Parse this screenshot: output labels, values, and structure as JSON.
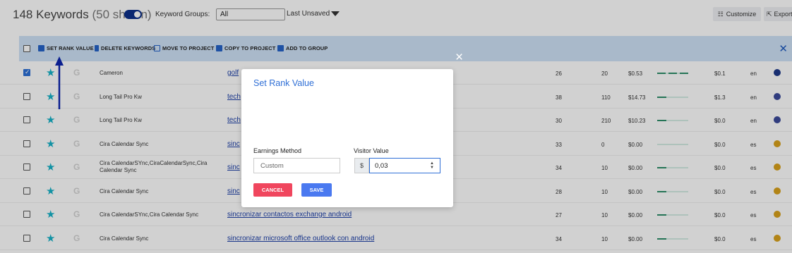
{
  "header": {
    "keyword_count": "148 Keywords",
    "shown_count": "(50 shown)",
    "keyword_groups_label": "Keyword Groups:",
    "keyword_groups_value": "All",
    "view_label": "Last Unsaved",
    "customize_label": "Customize",
    "export_label": "Export"
  },
  "action_bar": {
    "set_rank_value": "SET RANK VALUE",
    "delete_keywords": "DELETE KEYWORDS",
    "move_to_project": "MOVE TO PROJECT",
    "copy_to_project": "COPY TO PROJECT",
    "add_to_group": "ADD TO GROUP"
  },
  "rows": [
    {
      "group": "Cameron",
      "keyword": "golf",
      "c1": "26",
      "c2": "20",
      "c3": "$0.53",
      "trend": "dash",
      "trend_level": 1.0,
      "c5": "$0.1",
      "lang": "en",
      "checked": true,
      "flag_color": "#1f3a8a"
    },
    {
      "group": "Long Tail Pro Kw",
      "keyword": "tech",
      "c1": "38",
      "c2": "110",
      "c3": "$14.73",
      "trend": "bar",
      "trend_level": 0.3,
      "c5": "$1.3",
      "lang": "en",
      "checked": false,
      "flag_color": "#3b4a9a"
    },
    {
      "group": "Long Tail Pro Kw",
      "keyword": "tech",
      "c1": "30",
      "c2": "210",
      "c3": "$10.23",
      "trend": "bar",
      "trend_level": 0.3,
      "c5": "$0.0",
      "lang": "en",
      "checked": false,
      "flag_color": "#3b4a9a"
    },
    {
      "group": "Cira Calendar Sync",
      "keyword": "sinc",
      "c1": "33",
      "c2": "0",
      "c3": "$0.00",
      "trend": "bar",
      "trend_level": 0.0,
      "c5": "$0.0",
      "lang": "es",
      "checked": false,
      "flag_color": "#d9a21b"
    },
    {
      "group": "Cira CalendarSYnc,CiraCalendarSync,Cira Calendar Sync",
      "keyword": "sinc",
      "c1": "34",
      "c2": "10",
      "c3": "$0.00",
      "trend": "bar",
      "trend_level": 0.3,
      "c5": "$0.0",
      "lang": "es",
      "checked": false,
      "flag_color": "#d9a21b"
    },
    {
      "group": "Cira Calendar Sync",
      "keyword": "sinc",
      "c1": "28",
      "c2": "10",
      "c3": "$0.00",
      "trend": "bar",
      "trend_level": 0.3,
      "c5": "$0.0",
      "lang": "es",
      "checked": false,
      "flag_color": "#d9a21b"
    },
    {
      "group": "Cira CalendarSYnc,Cira Calendar Sync",
      "keyword": "sincronizar contactos exchange android",
      "c1": "27",
      "c2": "10",
      "c3": "$0.00",
      "trend": "bar",
      "trend_level": 0.3,
      "c5": "$0.0",
      "lang": "es",
      "checked": false,
      "flag_color": "#d9a21b"
    },
    {
      "group": "Cira Calendar Sync",
      "keyword": "sincronizar microsoft office outlook con android",
      "c1": "34",
      "c2": "10",
      "c3": "$0.00",
      "trend": "bar",
      "trend_level": 0.3,
      "c5": "$0.0",
      "lang": "es",
      "checked": false,
      "flag_color": "#d9a21b"
    }
  ],
  "modal": {
    "title": "Set Rank Value",
    "earnings_method_label": "Earnings Method",
    "earnings_method_value": "Custom",
    "visitor_value_label": "Visitor Value",
    "currency_prefix": "$",
    "visitor_value": "0,03",
    "cancel_label": "CANCEL",
    "save_label": "SAVE",
    "close_icon": "×"
  },
  "colors": {
    "accent_blue": "#2f6fd6",
    "star": "#17b3c8",
    "cancel": "#f0465e",
    "save": "#4a79f0",
    "action_bar_bg": "#cfe2f7"
  }
}
